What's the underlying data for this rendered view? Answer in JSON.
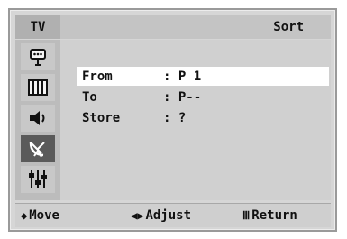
{
  "header": {
    "source_label": "TV",
    "title": "Sort"
  },
  "sidebar": {
    "items": [
      {
        "icon": "remote-antenna-icon",
        "active": false
      },
      {
        "icon": "picture-icon",
        "active": false
      },
      {
        "icon": "speaker-icon",
        "active": false
      },
      {
        "icon": "satellite-dish-icon",
        "active": true
      },
      {
        "icon": "settings-sliders-icon",
        "active": false
      }
    ]
  },
  "menu": {
    "rows": [
      {
        "label": "From",
        "value": ": P 1",
        "selected": true
      },
      {
        "label": "To",
        "value": ": P--",
        "selected": false
      },
      {
        "label": "Store",
        "value": ": ?",
        "selected": false
      }
    ]
  },
  "footer": {
    "move_symbol": "◆",
    "move_label": "Move",
    "adjust_symbol": "◀▶",
    "adjust_label": "Adjust",
    "return_symbol": "Ⅲ",
    "return_label": "Return"
  }
}
